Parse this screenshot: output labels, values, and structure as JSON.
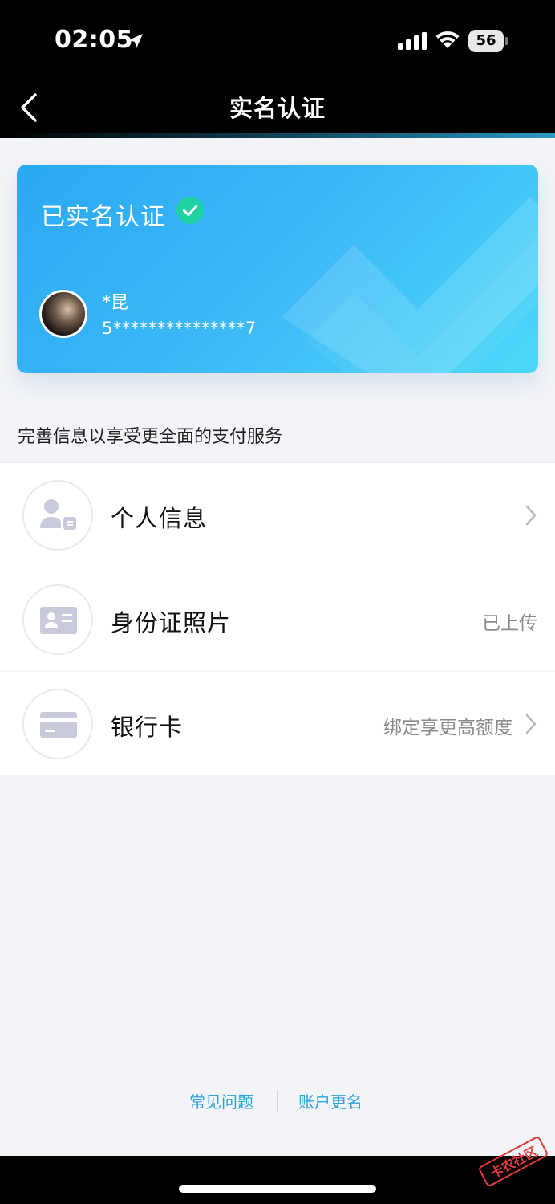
{
  "status_bar": {
    "time": "02:05",
    "battery": "56"
  },
  "nav": {
    "title": "实名认证"
  },
  "card": {
    "title": "已实名认证",
    "name": "*昆",
    "id_number": "5***************7"
  },
  "hint": "完善信息以享受更全面的支付服务",
  "rows": [
    {
      "label": "个人信息",
      "value": ""
    },
    {
      "label": "身份证照片",
      "value": "已上传"
    },
    {
      "label": "银行卡",
      "value": "绑定享更高额度"
    }
  ],
  "footer": {
    "faq": "常见问题",
    "rename": "账户更名"
  },
  "watermark": "卡农社区",
  "colors": {
    "accent": "#2ea3d9",
    "card_start": "#2aa9f4",
    "card_end": "#4ad9f8",
    "verified": "#1fd0a0"
  }
}
